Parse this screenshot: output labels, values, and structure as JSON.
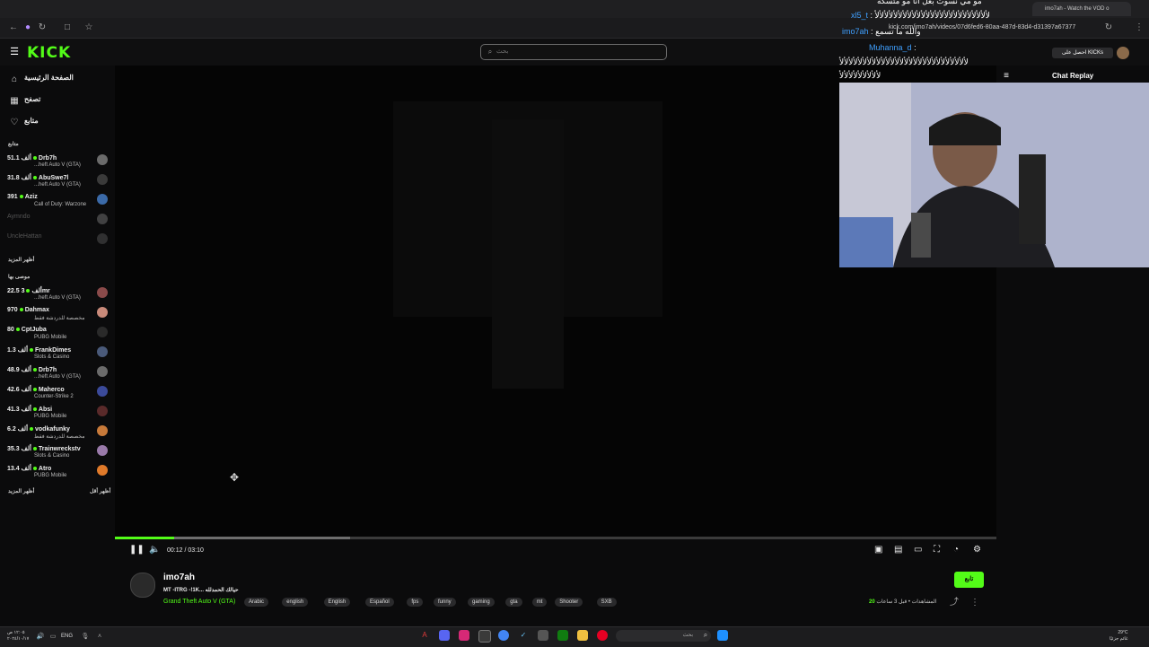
{
  "browser": {
    "tab_title": "imo7ah - Watch the VOD o",
    "url": "kick.com/imo7ah/videos/07d6fed6-80aa-487d-83d4-d31397a67377"
  },
  "header": {
    "logo": "KICK",
    "search_placeholder": "بحث"
  },
  "sidebar": {
    "nav": [
      {
        "label": "الصفحة الرئيسية",
        "icon": "home-icon"
      },
      {
        "label": "تصفح",
        "icon": "browse-icon"
      },
      {
        "label": "متابع",
        "icon": "heart-icon"
      }
    ],
    "following_title": "متابع",
    "following": [
      {
        "viewers": "51.1 ألف",
        "name": "Drb7h",
        "game": "...heft Auto V (GTA)",
        "avatar": "#6b6b6b",
        "online": true
      },
      {
        "viewers": "31.8 ألف",
        "name": "AbuSwe7l",
        "game": "...heft Auto V (GTA)",
        "avatar": "#3a3a3a",
        "online": true
      },
      {
        "viewers": "391",
        "name": "Aziz",
        "game": "Call of Duty: Warzone",
        "avatar": "#3b6aa8",
        "online": true
      },
      {
        "viewers": "",
        "name": "Aymndo",
        "game": "",
        "avatar": "#777777",
        "online": false
      },
      {
        "viewers": "",
        "name": "UncleHattan",
        "game": "",
        "avatar": "#555555",
        "online": false
      }
    ],
    "show_more_1": "أظهر المزيد",
    "recommended_title": "موصى بها",
    "recommended": [
      {
        "viewers": "22.5 ألف",
        "name": "3mr",
        "game": "...heft Auto V (GTA)",
        "avatar": "#8a4a4a",
        "online": true
      },
      {
        "viewers": "970",
        "name": "Dahmax",
        "game": "مخصصة للدردشة فقط",
        "avatar": "#c98a7a",
        "online": true
      },
      {
        "viewers": "80",
        "name": "CptJuba",
        "game": "PUBG Mobile",
        "avatar": "#2a2a2a",
        "online": true
      },
      {
        "viewers": "1.3 ألف",
        "name": "FrankDimes",
        "game": "Slots & Casino",
        "avatar": "#4a5a7a",
        "online": true
      },
      {
        "viewers": "48.9 ألف",
        "name": "Drb7h",
        "game": "...heft Auto V (GTA)",
        "avatar": "#6b6b6b",
        "online": true
      },
      {
        "viewers": "42.6 ألف",
        "name": "Maherco",
        "game": "Counter-Strike 2",
        "avatar": "#3b4a9a",
        "online": true
      },
      {
        "viewers": "41.3 ألف",
        "name": "Absi",
        "game": "PUBG Mobile",
        "avatar": "#5a2a2a",
        "online": true
      },
      {
        "viewers": "6.2 ألف",
        "name": "vodkafunky",
        "game": "مخصصة للدردشة فقط",
        "avatar": "#c87a3a",
        "online": true
      },
      {
        "viewers": "35.3 ألف",
        "name": "Trainwreckstv",
        "game": "Slots & Casino",
        "avatar": "#9a7aaa",
        "online": true
      },
      {
        "viewers": "13.4 ألف",
        "name": "Atro",
        "game": "PUBG Mobile",
        "avatar": "#e07a2a",
        "online": true
      }
    ],
    "show_more_2": "أظهر المزيد",
    "show_less": "أظهر أقل"
  },
  "player": {
    "time": "00:12 / 03:10",
    "progress": 0.067,
    "buffered": 0.267
  },
  "chat": {
    "lines": [
      {
        "user": "",
        "text": "مو مي نسوت بعل انا مو متسكه"
      },
      {
        "user": "xl5_t",
        "text": ": ﻷﻷﻷﻷﻷﻷﻷﻷﻷﻷﻷﻷﻷﻷﻷﻷﻷﻷﻷﻷﻷﻷﻷﻷﻷ"
      },
      {
        "user": "imo7ah",
        "text": ": والله ما تسمع"
      },
      {
        "user": "Muhanna_d",
        "text": ":"
      },
      {
        "user": "",
        "text": "ﻷﻷﻷﻷﻷﻷﻷﻷﻷﻷﻷﻷﻷﻷﻷﻷﻷﻷﻷﻷﻷﻷﻷﻷﻷﻷﻷﻷ"
      },
      {
        "user": "",
        "text": "ﻷﻷﻷﻷﻷﻷﻷﻷﻷ"
      }
    ],
    "kicks_button": "احصل على KICKs",
    "replay_label": "Chat Replay"
  },
  "stream": {
    "streamer": "imo7ah",
    "title": "MT -ITRG -!1K... حيالك الحمدلله",
    "category": "Grand Theft Auto V (GTA)",
    "tags": [
      "Arabic",
      "english",
      "English",
      "Español",
      "fps",
      "funny",
      "gaming",
      "gta",
      "mt",
      "Shooter",
      "SXB"
    ],
    "follow_label": "تابع",
    "views_count": "20",
    "views_text": "المشاهدات • قبل 3 ساعات"
  },
  "taskbar": {
    "search_placeholder": "بحث",
    "lang": "ENG",
    "time": "١٢:٠٥ ص",
    "date": "٢٠٢٤/١٠/١٧",
    "weather_temp": "29°C",
    "weather_desc": "غائم جزئيًا"
  },
  "colors": {
    "accent": "#53fc18",
    "background": "#0b0b0c",
    "username": "#3fa0ff"
  }
}
